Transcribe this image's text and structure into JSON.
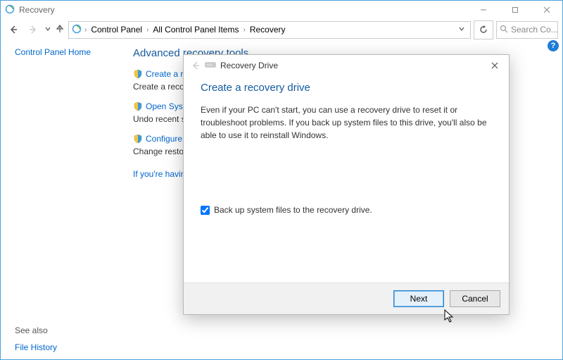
{
  "window": {
    "title": "Recovery"
  },
  "titlebar": {
    "minimize": "—",
    "maximize": "▢",
    "close": "✕"
  },
  "nav": {
    "crumbs": [
      "Control Panel",
      "All Control Panel Items",
      "Recovery"
    ],
    "search_placeholder": "Search Co..."
  },
  "left": {
    "home": "Control Panel Home",
    "see_also": "See also",
    "file_history": "File History"
  },
  "main": {
    "heading": "Advanced recovery tools",
    "tools": [
      {
        "link": "Create a recovery drive",
        "desc": "Create a recovery drive to troubleshoot problems when your PC can't start."
      },
      {
        "link": "Open System Restore",
        "desc": "Undo recent system changes, but leave files such as documents, pictures, and music unchanged."
      },
      {
        "link": "Configure System Restore",
        "desc": "Change restore settings, manage disk space, and create or delete restore points."
      }
    ],
    "problems": "If you're having problems with your PC, go to Settings and try resetting it"
  },
  "dialog": {
    "wizard_title": "Recovery Drive",
    "heading": "Create a recovery drive",
    "body": "Even if your PC can't start, you can use a recovery drive to reset it or troubleshoot problems. If you back up system files to this drive, you'll also be able to use it to reinstall Windows.",
    "checkbox_label": "Back up system files to the recovery drive.",
    "next": "Next",
    "cancel": "Cancel"
  },
  "help": "?"
}
